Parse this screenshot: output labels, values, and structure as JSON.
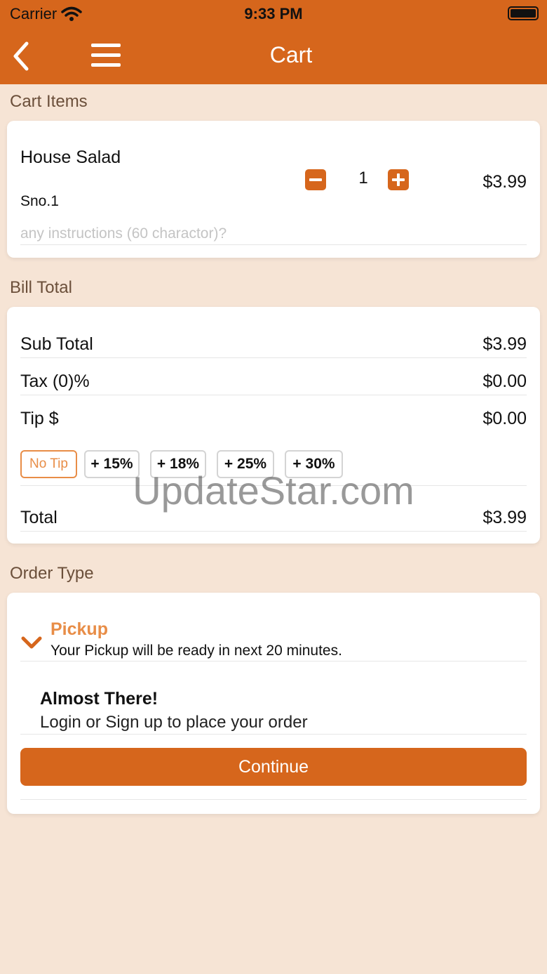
{
  "status_bar": {
    "carrier": "Carrier",
    "time": "9:33 PM"
  },
  "header": {
    "title": "Cart",
    "back_icon": "chevron-left-icon",
    "menu_icon": "hamburger-menu-icon"
  },
  "cart_items": {
    "section_label": "Cart Items",
    "items": [
      {
        "name": "House Salad",
        "sno": "Sno.1",
        "quantity": "1",
        "price": "$3.99",
        "instructions_placeholder": "any instructions (60 charactor)?"
      }
    ]
  },
  "bill_total": {
    "section_label": "Bill Total",
    "sub_total_label": "Sub Total",
    "sub_total_value": "$3.99",
    "tax_label": "Tax (0)%",
    "tax_value": "$0.00",
    "tip_label": "Tip $",
    "tip_value": "$0.00",
    "tip_options": [
      "No Tip",
      "+ 15%",
      "+ 18%",
      "+ 25%",
      "+ 30%"
    ],
    "selected_tip": "No Tip",
    "total_label": "Total",
    "total_value": "$3.99"
  },
  "order_type": {
    "section_label": "Order Type",
    "pickup_title": "Pickup",
    "pickup_desc": "Your Pickup will be ready in next 20 minutes.",
    "almost_title": "Almost There!",
    "login_msg": "Login or Sign up to place your order",
    "continue_label": "Continue"
  },
  "watermark": "UpdateStar.com",
  "colors": {
    "accent": "#d6661c",
    "accent_light": "#e88d47",
    "background": "#f6e4d5"
  }
}
